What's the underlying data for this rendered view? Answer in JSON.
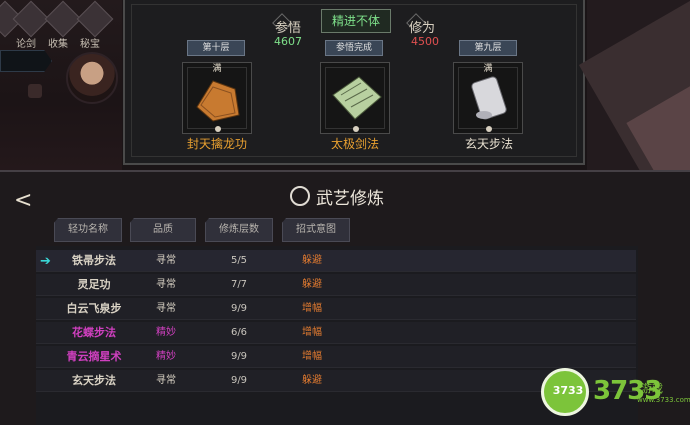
{
  "hud": {
    "buttons": [
      {
        "label": "",
        "icon": "menu-icon"
      },
      {
        "label": "论剑",
        "icon": "sword-icon"
      },
      {
        "label": "收集",
        "icon": "collection-icon"
      },
      {
        "label": "秘宝",
        "icon": "treasure-icon"
      }
    ]
  },
  "top_panel": {
    "center_status": "精进不体",
    "comprehension_label": "参悟",
    "comprehension_value": "4607",
    "cultivation_label": "修为",
    "cultivation_value": "4500",
    "skills": [
      {
        "tag": "第十层",
        "status": "满",
        "name": "封天擒龙功",
        "name_color": "#e8a030",
        "icon": "dragon-scroll-icon"
      },
      {
        "tag": "参悟完成",
        "status": "",
        "name": "太极剑法",
        "name_color": "#e8a030",
        "icon": "sword-manual-icon"
      },
      {
        "tag": "第九层",
        "status": "满",
        "name": "玄天步法",
        "name_color": "#e8e0d0",
        "icon": "step-scroll-icon"
      }
    ]
  },
  "bottom_panel": {
    "title": "武艺修炼",
    "tabs": [
      "轻功名称",
      "品质",
      "修炼层数",
      "招式意图"
    ],
    "rows": [
      {
        "name": "铁帚步法",
        "quality": "寻常",
        "layers": "5/5",
        "effect": "躲避",
        "name_color": "#e8e0d0",
        "quality_color": "#c8c4bc",
        "selected": true
      },
      {
        "name": "灵足功",
        "quality": "寻常",
        "layers": "7/7",
        "effect": "躲避",
        "name_color": "#e8e0d0",
        "quality_color": "#c8c4bc",
        "selected": false
      },
      {
        "name": "白云飞泉步",
        "quality": "寻常",
        "layers": "9/9",
        "effect": "增幅",
        "name_color": "#e8e0d0",
        "quality_color": "#c8c4bc",
        "selected": false
      },
      {
        "name": "花蝶步法",
        "quality": "精妙",
        "layers": "6/6",
        "effect": "增幅",
        "name_color": "#d040c0",
        "quality_color": "#d040c0",
        "selected": false
      },
      {
        "name": "青云摘星术",
        "quality": "精妙",
        "layers": "9/9",
        "effect": "增幅",
        "name_color": "#d040c0",
        "quality_color": "#d040c0",
        "selected": false
      },
      {
        "name": "玄天步法",
        "quality": "寻常",
        "layers": "9/9",
        "effect": "躲避",
        "name_color": "#e8e0d0",
        "quality_color": "#c8c4bc",
        "selected": false
      }
    ]
  },
  "watermark": {
    "circle_text": "3733",
    "main_text": "3733",
    "sub_text": "游戏",
    "url": "www.3733.com"
  },
  "colors": {
    "green": "#7ee08a",
    "red": "#e05050",
    "orange": "#e07a30",
    "magenta": "#d040c0"
  }
}
